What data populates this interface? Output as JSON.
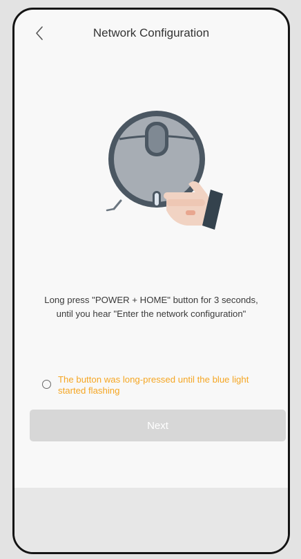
{
  "header": {
    "title": "Network Configuration",
    "back_icon": "chevron-left-icon"
  },
  "illustration": {
    "description_icon": "robot-vacuum-hand-press-icon",
    "colors": {
      "body": "#a7adb4",
      "rim": "#4b5762",
      "hand": "#f1d3c3",
      "cuff": "#34424d"
    }
  },
  "instruction": {
    "line1": "Long press \"POWER + HOME\" button for 3 seconds,",
    "line2": "until you hear \"Enter the network configuration\""
  },
  "confirm": {
    "line1": "The button was long-pressed until the blue light",
    "line2": "started flashing",
    "checked": false,
    "color": "#f5a623"
  },
  "next_button": {
    "label": "Next",
    "enabled": false
  }
}
